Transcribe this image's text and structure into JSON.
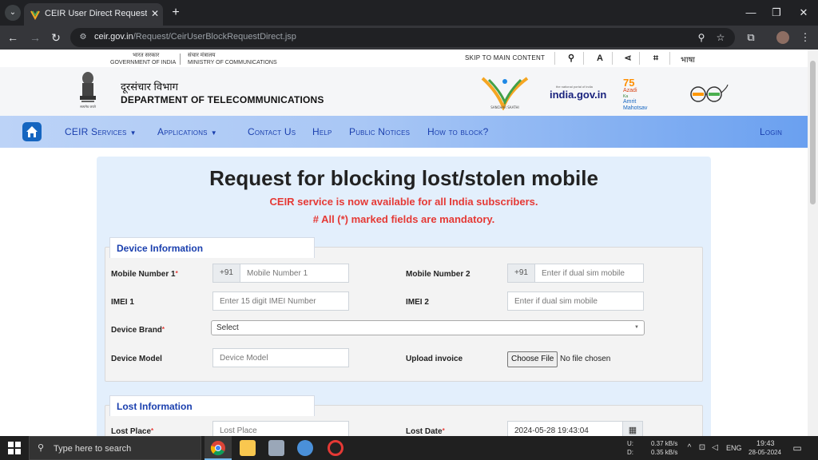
{
  "browser": {
    "tab_title": "CEIR User Direct Request Blocking",
    "url_host": "ceir.gov.in",
    "url_path": "/Request/CeirUserBlockRequestDirect.jsp"
  },
  "topbar": {
    "gov_india_hi": "भारत सरकार",
    "gov_india_en": "GOVERNMENT OF INDIA",
    "ministry_hi": "संचार मंत्रालय",
    "ministry_en": "MINISTRY OF COMMUNICATIONS",
    "skip": "SKIP TO MAIN CONTENT",
    "font_size": "A",
    "language": "भाषा"
  },
  "header": {
    "dept_hi": "दूरसंचार विभाग",
    "dept_en": "DEPARTMENT OF TELECOMMUNICATIONS",
    "emblem_caption": "सत्यमेव जयते",
    "logo_india_gov": "india.gov.in",
    "logo_india_gov_tag": "the national portal of india",
    "logo_sanchar_saathi": "SANCHAR SAATHI",
    "logo_azadi": "Azadi",
    "logo_ka": "Ka",
    "logo_amrit": "Amrit",
    "logo_mahotsav": "Mahotsav",
    "logo_75": "75"
  },
  "nav": {
    "items": [
      {
        "label": "CEIR Services",
        "has_caret": true
      },
      {
        "label": "Applications",
        "has_caret": true
      },
      {
        "label": "Contact Us"
      },
      {
        "label": "Help"
      },
      {
        "label": "Public Notices"
      },
      {
        "label": "How to block?"
      }
    ],
    "login": "Login"
  },
  "form": {
    "title": "Request for blocking lost/stolen mobile",
    "notice1": "CEIR service is now available for all India subscribers.",
    "notice2": "# All (*) marked fields are mandatory.",
    "device_section": "Device Information",
    "lost_section": "Lost Information",
    "mobile1_label": "Mobile Number 1",
    "mobile1_prefix": "+91",
    "mobile1_placeholder": "Mobile Number 1",
    "mobile2_label": "Mobile Number 2",
    "mobile2_prefix": "+91",
    "mobile2_placeholder": "Enter if dual sim mobile",
    "imei1_label": "IMEI 1",
    "imei1_placeholder": "Enter 15 digit IMEI Number",
    "imei2_label": "IMEI 2",
    "imei2_placeholder": "Enter if dual sim mobile",
    "brand_label": "Device Brand",
    "brand_value": "Select",
    "model_label": "Device Model",
    "model_placeholder": "Device Model",
    "invoice_label": "Upload invoice",
    "file_button": "Choose File",
    "file_status": "No file chosen",
    "lost_place_label": "Lost Place",
    "lost_place_placeholder": "Lost Place",
    "lost_date_label": "Lost Date",
    "lost_date_value": "2024-05-28 19:43:04",
    "required_mark": "*"
  },
  "taskbar": {
    "search_placeholder": "Type here to search",
    "net_up_label": "U:",
    "net_down_label": "D:",
    "net_up": "0.37 kB/s",
    "net_down": "0.35 kB/s",
    "lang": "ENG",
    "time": "19:43",
    "date": "28-05-2024"
  },
  "colors": {
    "nav_text": "#1a3fae",
    "notice_red": "#e53935",
    "card_bg": "#e3effc"
  }
}
